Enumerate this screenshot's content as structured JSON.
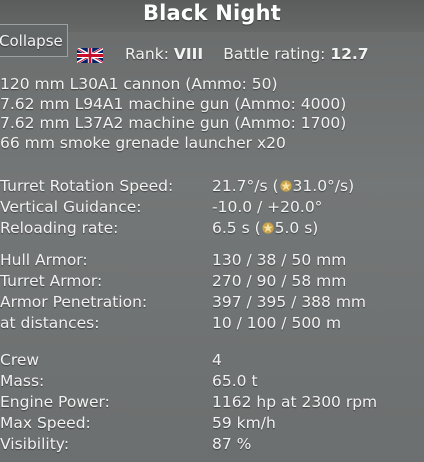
{
  "window": {
    "title": "Black Night",
    "collapse_label": "Collapse"
  },
  "header": {
    "rank_label": "Rank:",
    "rank_value": "VIII",
    "br_label": "Battle rating:",
    "br_value": "12.7",
    "flag_icon": "uk-flag-icon"
  },
  "weapons": [
    "120 mm L30A1 cannon (Ammo: 50)",
    "7.62 mm L94A1 machine gun (Ammo: 4000)",
    "7.62 mm L37A2 machine gun (Ammo: 1700)",
    "66 mm smoke grenade launcher x20"
  ],
  "mobility": {
    "turret_rotation_label": "Turret Rotation Speed:",
    "turret_rotation_base": "21.7°/s (",
    "turret_rotation_upgraded": "31.0°/s)",
    "vertical_guidance_label": "Vertical Guidance:",
    "vertical_guidance_value": "-10.0 / +20.0°",
    "reloading_label": "Reloading rate:",
    "reloading_base": "6.5 s (",
    "reloading_upgraded": "5.0 s)",
    "upgrade_icon": "star-icon"
  },
  "armor": {
    "hull_label": "Hull Armor:",
    "hull_value": "130 / 38 / 50 mm",
    "turret_label": "Turret Armor:",
    "turret_value": "270 / 90 / 58 mm",
    "penetration_label": "Armor Penetration:",
    "penetration_value": "397 / 395 / 388 mm",
    "distances_label": "at distances:",
    "distances_value": "10 / 100 / 500 m"
  },
  "specs": {
    "crew_label": "Crew",
    "crew_value": "4",
    "mass_label": "Mass:",
    "mass_value": "65.0 t",
    "engine_label": "Engine Power:",
    "engine_value": "1162 hp at 2300 rpm",
    "speed_label": "Max Speed:",
    "speed_value": "59 km/h",
    "visibility_label": "Visibility:",
    "visibility_value": "87 %"
  }
}
